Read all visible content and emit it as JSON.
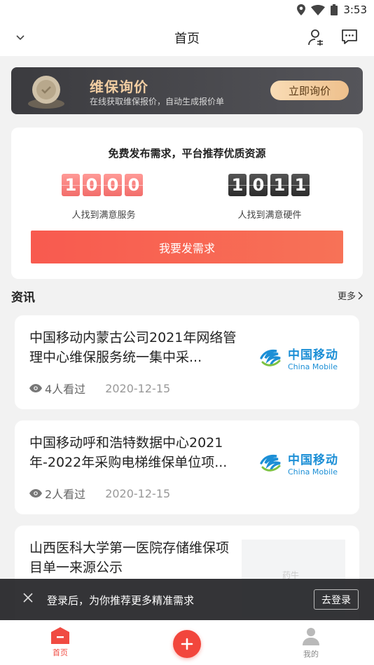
{
  "status_bar": {
    "time": "3:53"
  },
  "header": {
    "title": "首页"
  },
  "banner": {
    "title": "维保询价",
    "subtitle": "在线获取维保报价，自动生成报价单",
    "button": "立即询价"
  },
  "demand": {
    "title": "免费发布需求，平台推荐优质资源",
    "service_digits": [
      "1",
      "0",
      "0",
      "0"
    ],
    "service_label": "人找到满意服务",
    "hardware_digits": [
      "1",
      "0",
      "1",
      "1"
    ],
    "hardware_label": "人找到满意硬件",
    "button": "我要发需求"
  },
  "news": {
    "title": "资讯",
    "more": "更多",
    "items": [
      {
        "title": "中国移动内蒙古公司2021年网络管理中心维保服务统一集中采...",
        "views": "4人看过",
        "date": "2020-12-15",
        "logo_cn": "中国移动",
        "logo_en": "China Mobile"
      },
      {
        "title": "中国移动呼和浩特数据中心2021年-2022年采购电梯维保单位项...",
        "views": "2人看过",
        "date": "2020-12-15",
        "logo_cn": "中国移动",
        "logo_en": "China Mobile"
      },
      {
        "title": "山西医科大学第一医院存储维保项目单一来源公示",
        "watermark": "药牛"
      }
    ]
  },
  "toast": {
    "text": "登录后，为你推荐更多精准需求",
    "button": "去登录"
  },
  "tabbar": {
    "home": "首页",
    "me": "我的"
  },
  "colors": {
    "accent": "#f04b42",
    "banner_gold": "#f1cda2",
    "cm_blue": "#1c8fd6"
  }
}
